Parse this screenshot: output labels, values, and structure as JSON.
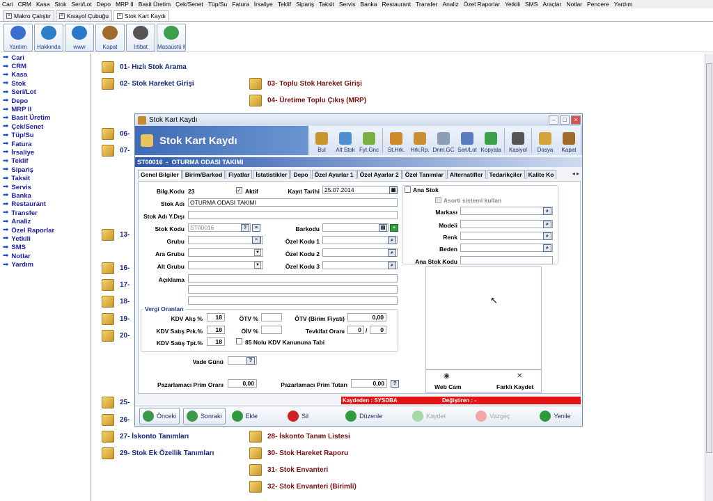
{
  "menu": [
    "Cari",
    "CRM",
    "Kasa",
    "Stok",
    "Seri/Lot",
    "Depo",
    "MRP II",
    "Basit Üretim",
    "Çek/Senet",
    "Tüp/Su",
    "Fatura",
    "İrsaliye",
    "Teklif",
    "Sipariş",
    "Taksit",
    "Servis",
    "Banka",
    "Restaurant",
    "Transfer",
    "Analiz",
    "Özel Raporlar",
    "Yetkili",
    "SMS",
    "Araçlar",
    "Notlar",
    "Pencere",
    "Yardım"
  ],
  "top_tabs": [
    "Makro Çalıştır",
    "Kısayol Çubuğu",
    "Stok Kart Kaydı"
  ],
  "toolbar": [
    {
      "label": "Yardım",
      "icon": "help-icon",
      "color": "#3a6fd0"
    },
    {
      "label": "Hakkında",
      "icon": "info-icon",
      "color": "#2c7fc9"
    },
    {
      "label": "www",
      "icon": "globe-icon",
      "color": "#2979c8"
    },
    {
      "label": "Kapat",
      "icon": "door-icon",
      "color": "#a06a2a"
    },
    {
      "label": "İrtibat",
      "icon": "phone-icon",
      "color": "#555"
    },
    {
      "label": "Masaüstü M",
      "icon": "desktop-icon",
      "color": "#3aa04a"
    }
  ],
  "left_nav": [
    "Cari",
    "CRM",
    "Kasa",
    "Stok",
    "Seri/Lot",
    "Depo",
    "MRP II",
    "Basit Üretim",
    "Çek/Senet",
    "Tüp/Su",
    "Fatura",
    "İrsaliye",
    "Teklif",
    "Sipariş",
    "Taksit",
    "Servis",
    "Banka",
    "Restaurant",
    "Transfer",
    "Analiz",
    "Özel Raporlar",
    "Yetkili",
    "SMS",
    "Notlar",
    "Yardım"
  ],
  "bg_items": {
    "i01": "01- Hızlı Stok Arama",
    "i02": "02- Stok Hareket Girişi",
    "i03": "03- Toplu Stok Hareket Girişi",
    "i04": "04- Üretime Toplu Çıkış (MRP)",
    "i06": "06-",
    "i07": "07-",
    "i13": "13-",
    "i16": "16-",
    "i17": "17-",
    "i18": "18-",
    "i19": "19-",
    "i20": "20-",
    "i25": "25-",
    "i26": "26-",
    "i27": "27- İskonto Tanımları",
    "i28": "28- İskonto Tanım Listesi",
    "i29": "29- Stok Ek Özellik Tanımları",
    "i30": "30- Stok Hareket Raporu",
    "i31": "31- Stok Envanteri",
    "i32": "32- Stok Envanteri (Birimli)"
  },
  "dialog": {
    "window_title": "Stok Kart Kaydı",
    "header_title": "Stok Kart Kaydı",
    "tools": [
      {
        "label": "Bul",
        "color": "#c9952b"
      },
      {
        "label": "Alt Stok",
        "color": "#4f8fd0"
      },
      {
        "label": "Fyt.Gnc",
        "color": "#7ab040"
      },
      {
        "label": "St.Hrk.",
        "color": "#d08a2a"
      },
      {
        "label": "Hrk.Rp.",
        "color": "#c98f35"
      },
      {
        "label": "Dnm.GC",
        "color": "#8c9db5"
      },
      {
        "label": "Seri/Lot",
        "color": "#5a7cc0"
      },
      {
        "label": "Kopyala",
        "color": "#3aa04a"
      },
      {
        "label": "Kasiyol",
        "color": "#555"
      },
      {
        "label": "Dosya",
        "color": "#d5a43a"
      },
      {
        "label": "Kapat",
        "color": "#a06a2a"
      }
    ],
    "record_code": "ST00016",
    "record_name": "OTURMA ODASI TAKIMI",
    "tabs": [
      "Genel Bilgiler",
      "Birim/Barkod",
      "Fiyatlar",
      "İstatistikler",
      "Depo",
      "Özel Ayarlar 1",
      "Özel Ayarlar 2",
      "Özel Tanımlar",
      "Alternatifler",
      "Tedarikçiler",
      "Kalite Ko"
    ],
    "form": {
      "bilg_kodu_label": "Bilg.Kodu",
      "bilg_kodu_value": "23",
      "aktif_label": "Aktif",
      "kayit_tarihi_label": "Kayıt Tarihi",
      "kayit_tarihi": "25.07.2014",
      "stok_adi_label": "Stok Adı",
      "stok_adi": "OTURMA ODASI TAKIMI",
      "stok_adi_ydisi_label": "Stok Adı Y.Dışı",
      "stok_kodu_label": "Stok Kodu",
      "stok_kodu": "ST00016",
      "barkodu_label": "Barkodu",
      "grubu_label": "Grubu",
      "ara_grubu_label": "Ara Grubu",
      "alt_grubu_label": "Alt Grubu",
      "ozel_kodu1_label": "Özel Kodu 1",
      "ozel_kodu2_label": "Özel Kodu 2",
      "ozel_kodu3_label": "Özel Kodu 3",
      "aciklama_label": "Açıklama",
      "vergi_title": "Vergi Oranları",
      "kdv_alis_label": "KDV Alış %",
      "kdv_alis": "18",
      "kdv_satis_prk_label": "KDV Satış Prk.%",
      "kdv_satis_prk": "18",
      "kdv_satis_tpt_label": "KDV Satış Tpt.%",
      "kdv_satis_tpt": "18",
      "otv_label": "ÖTV %",
      "oiv_label": "ÖİV %",
      "otv_birim_label": "ÖTV (Birim Fiyatı)",
      "otv_birim": "0,00",
      "tevkifat_label": "Tevkifat Oranı",
      "tevkifat_a": "0",
      "tevkifat_sep": "/",
      "tevkifat_b": "0",
      "kdv85_label": "85 Nolu KDV Kanununa Tabi",
      "vade_gunu_label": "Vade Günü",
      "prim_orani_label": "Pazarlamacı Prim Oranı",
      "prim_orani": "0,00",
      "prim_tutari_label": "Pazarlamacı Prim Tutarı",
      "prim_tutari": "0,00",
      "ana_stok_label": "Ana Stok",
      "asorti_label": "Asorti sistemi kullan",
      "markasi_label": "Markası",
      "modeli_label": "Modeli",
      "renk_label": "Renk",
      "beden_label": "Beden",
      "ana_stok_kodu_label": "Ana Stok Kodu",
      "webcam_label": "Web Cam",
      "farkli_kaydet_label": "Farklı Kaydet"
    },
    "status": {
      "kaydeden": "Kaydeden : SYSDBA",
      "degistiren": "Değiştiren : -"
    },
    "buttons": [
      {
        "label": "Önceki",
        "color": "#3a9a48",
        "boxed": true,
        "disabled": false
      },
      {
        "label": "Sonraki",
        "color": "#3a9a48",
        "boxed": true,
        "disabled": false
      },
      {
        "label": "Ekle",
        "color": "#2f9a3c",
        "boxed": false,
        "disabled": false
      },
      {
        "label": "Sil",
        "color": "#d02020",
        "boxed": false,
        "disabled": false
      },
      {
        "label": "Düzenle",
        "color": "#2f9a3c",
        "boxed": false,
        "disabled": false
      },
      {
        "label": "Kaydet",
        "color": "#a8d8a8",
        "boxed": false,
        "disabled": true
      },
      {
        "label": "Vazgeç",
        "color": "#f0a8a8",
        "boxed": false,
        "disabled": true
      },
      {
        "label": "Yenile",
        "color": "#2f9a3c",
        "boxed": false,
        "disabled": false
      }
    ]
  }
}
